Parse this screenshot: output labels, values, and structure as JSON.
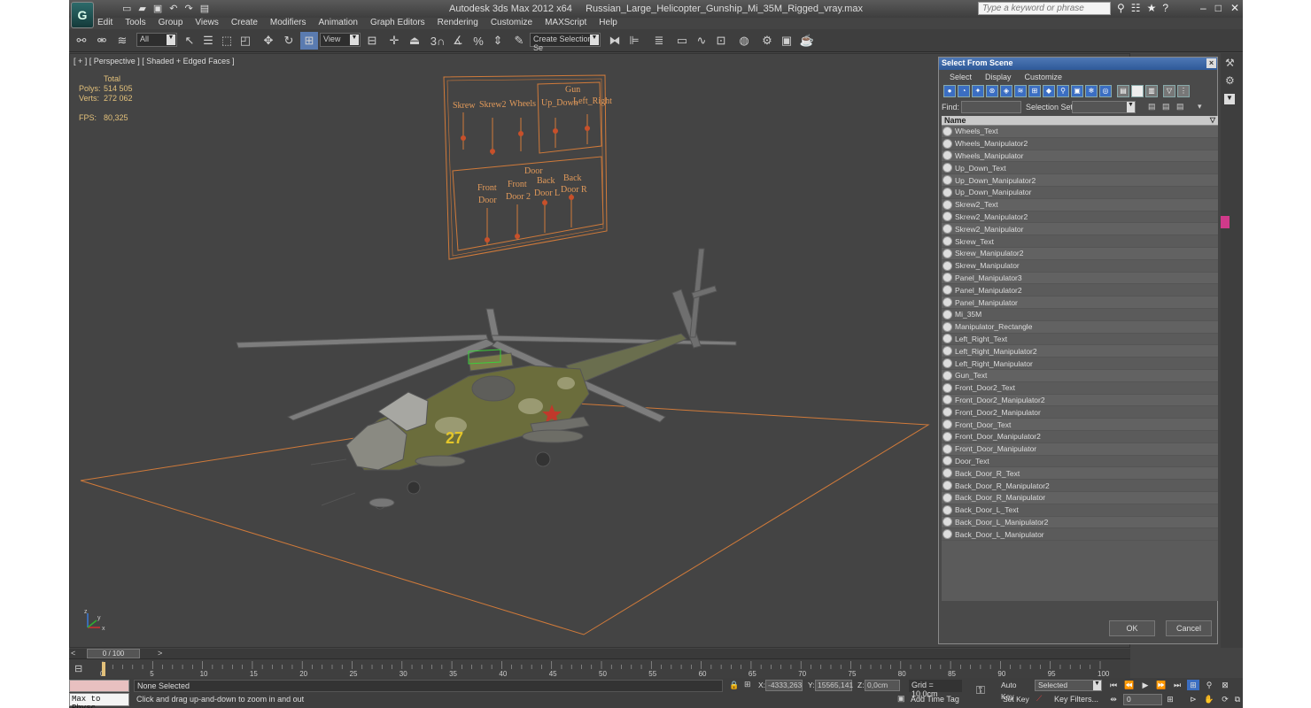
{
  "title_bar": {
    "app_name": "Autodesk 3ds Max  2012 x64",
    "file_name": "Russian_Large_Helicopter_Gunship_Mi_35M_Rigged_vray.max",
    "search_placeholder": "Type a keyword or phrase",
    "logo_letter": "G"
  },
  "menu": [
    "Edit",
    "Tools",
    "Group",
    "Views",
    "Create",
    "Modifiers",
    "Animation",
    "Graph Editors",
    "Rendering",
    "Customize",
    "MAXScript",
    "Help"
  ],
  "toolbar": {
    "filter_value": "All",
    "view_value": "View",
    "snap_label": "3",
    "percent_label": "%",
    "selection_set_value": "Create Selection Se"
  },
  "viewport": {
    "label": "[ + ] [ Perspective ] [ Shaded + Edged Faces ]",
    "stats": {
      "header": "Total",
      "polys_label": "Polys:",
      "polys_value": "514 505",
      "verts_label": "Verts:",
      "verts_value": "272 062",
      "fps_label": "FPS:",
      "fps_value": "80,325"
    },
    "control_panel": {
      "top_labels": [
        "Skrew",
        "Skrew2",
        "Wheels"
      ],
      "gun_label": "Gun",
      "gun_sub": [
        "Up_Down",
        "Left_Right"
      ],
      "door_label": "Door",
      "door_sub": [
        [
          "Front",
          "Door"
        ],
        [
          "Front",
          "Door 2"
        ],
        [
          "Back",
          "Door L"
        ],
        [
          "Back",
          "Door R"
        ]
      ]
    },
    "heli_number": "27",
    "axis_labels": [
      "z",
      "x",
      "y"
    ]
  },
  "dialog": {
    "title": "Select From Scene",
    "menu": [
      "Select",
      "Display",
      "Customize"
    ],
    "find_label": "Find:",
    "selection_set_label": "Selection Set:",
    "column_header": "Name",
    "items": [
      "Wheels_Text",
      "Wheels_Manipulator2",
      "Wheels_Manipulator",
      "Up_Down_Text",
      "Up_Down_Manipulator2",
      "Up_Down_Manipulator",
      "Skrew2_Text",
      "Skrew2_Manipulator2",
      "Skrew2_Manipulator",
      "Skrew_Text",
      "Skrew_Manipulator2",
      "Skrew_Manipulator",
      "Panel_Manipulator3",
      "Panel_Manipulator2",
      "Panel_Manipulator",
      "Mi_35M",
      "Manipulator_Rectangle",
      "Left_Right_Text",
      "Left_Right_Manipulator2",
      "Left_Right_Manipulator",
      "Gun_Text",
      "Front_Door2_Text",
      "Front_Door2_Manipulator2",
      "Front_Door2_Manipulator",
      "Front_Door_Text",
      "Front_Door_Manipulator2",
      "Front_Door_Manipulator",
      "Door_Text",
      "Back_Door_R_Text",
      "Back_Door_R_Manipulator2",
      "Back_Door_R_Manipulator",
      "Back_Door_L_Text",
      "Back_Door_L_Manipulator2",
      "Back_Door_L_Manipulator"
    ],
    "ok_label": "OK",
    "cancel_label": "Cancel"
  },
  "timeline": {
    "frame_display": "0 / 100",
    "ticks": [
      "0",
      "5",
      "10",
      "15",
      "20",
      "25",
      "30",
      "35",
      "40",
      "45",
      "50",
      "55",
      "60",
      "65",
      "70",
      "75",
      "80",
      "85",
      "90",
      "95",
      "100"
    ]
  },
  "status": {
    "maxscript_text": "Max to Physc",
    "selection_status": "None Selected",
    "prompt": "Click and drag up-and-down to zoom in and out",
    "x_label": "X:",
    "x_value": "-4333,263",
    "y_label": "Y:",
    "y_value": "15565,141",
    "z_label": "Z:",
    "z_value": "0,0cm",
    "grid": "Grid = 10,0cm",
    "add_time_tag": "Add Time Tag",
    "auto_key": "Auto Key",
    "set_key": "Set Key",
    "selected_value": "Selected",
    "key_filters": "Key Filters...",
    "frame_value": "0"
  },
  "colors": {
    "accent": "#3b6ec2",
    "wire_orange": "#d07a3a",
    "stats_yellow": "#e2c07a"
  }
}
